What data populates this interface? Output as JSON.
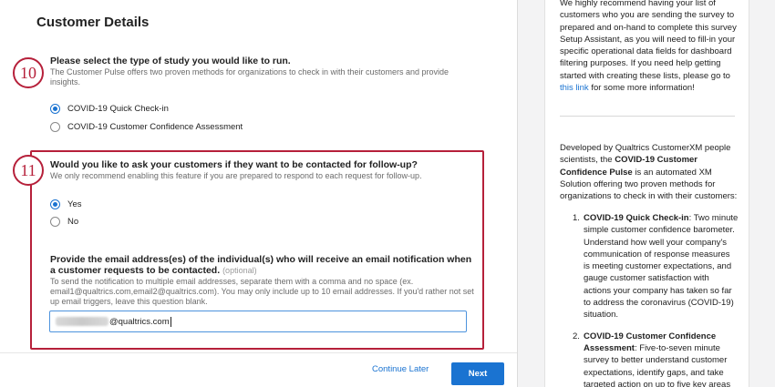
{
  "section": {
    "title": "Customer Details"
  },
  "markers": {
    "m10": "10",
    "m11": "11"
  },
  "q1": {
    "title": "Please select the type of study you would like to run.",
    "desc": "The Customer Pulse offers two proven methods for organizations to check in with their customers and provide insights.",
    "options": [
      {
        "label": "COVID-19 Quick Check-in",
        "selected": true
      },
      {
        "label": "COVID-19 Customer Confidence Assessment",
        "selected": false
      }
    ]
  },
  "q2": {
    "title": "Would you like to ask your customers if they want to be contacted for follow-up?",
    "desc": "We only recommend enabling this feature if you are prepared to respond to each request for follow-up.",
    "options": [
      {
        "label": "Yes",
        "selected": true
      },
      {
        "label": "No",
        "selected": false
      }
    ]
  },
  "q3": {
    "title": "Provide the email address(es) of the individual(s) who will receive an email notification when a customer requests to be contacted.",
    "optional": "(optional)",
    "desc": "To send the notification to multiple email addresses, separate them with a comma and no space (ex. email1@qualtrics.com,email2@qualtrics.com). You may only include up to 10 email addresses. If you'd rather not set up email triggers, leave this question blank.",
    "value_suffix": "@qualtrics.com"
  },
  "footer": {
    "continue_later": "Continue Later",
    "next": "Next"
  },
  "side": {
    "p1_text": "We highly recommend having your list of customers who you are sending the survey to prepared and on-hand to complete this survey Setup Assistant, as you will need to fill-in your specific operational data fields for dashboard filtering purposes. If you need help getting started with creating these lists, please go to",
    "p1_link": "this link",
    "p1_tail": "for some more information!",
    "p2_pre": "Developed by Qualtrics CustomerXM people scientists, the",
    "p2_bold": "COVID-19 Customer Confidence Pulse",
    "p2_post": "is an automated XM Solution offering two proven methods for organizations to check in with their customers:",
    "list": [
      {
        "num": "1.",
        "bold": "COVID-19 Quick Check-in",
        "text": ": Two minute simple customer confidence barometer. Understand how well your company's communication of response measures is meeting customer expectations, and gauge customer satisfaction with actions your company has taken so far to address the coronavirus (COVID-19) situation."
      },
      {
        "num": "2.",
        "bold": "COVID-19 Customer Confidence Assessment",
        "text": ": Five-to-seven minute survey to better understand customer expectations, identify gaps, and take targeted action on up to five key areas"
      }
    ]
  },
  "colors": {
    "accent": "#1a73d1",
    "marker": "#b6203a"
  }
}
